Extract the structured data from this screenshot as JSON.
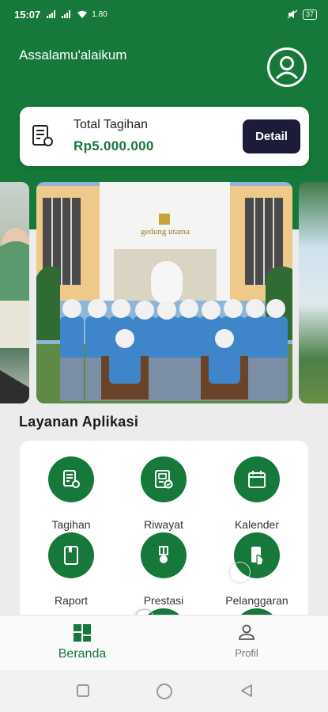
{
  "status_bar": {
    "time": "15:07",
    "network": "4G",
    "speed": "1.80",
    "battery": "37"
  },
  "header": {
    "greeting": "Assalamu'alaikum"
  },
  "bill": {
    "title": "Total Tagihan",
    "amount": "Rp5.000.000",
    "detail_label": "Detail"
  },
  "banner": {
    "building_sign": "gedung utama"
  },
  "services": {
    "title": "Layanan Aplikasi",
    "items": [
      {
        "label": "Tagihan",
        "icon": "invoice-icon"
      },
      {
        "label": "Riwayat",
        "icon": "history-icon"
      },
      {
        "label": "Kalender",
        "icon": "calendar-icon"
      },
      {
        "label": "Raport",
        "icon": "report-book-icon"
      },
      {
        "label": "Prestasi",
        "icon": "medal-icon"
      },
      {
        "label": "Pelanggaran",
        "icon": "violation-icon"
      }
    ]
  },
  "bottom_nav": {
    "home_label": "Beranda",
    "profile_label": "Profil"
  },
  "colors": {
    "primary": "#16783a",
    "dark_button": "#1d1b3a",
    "background": "#ececec"
  }
}
